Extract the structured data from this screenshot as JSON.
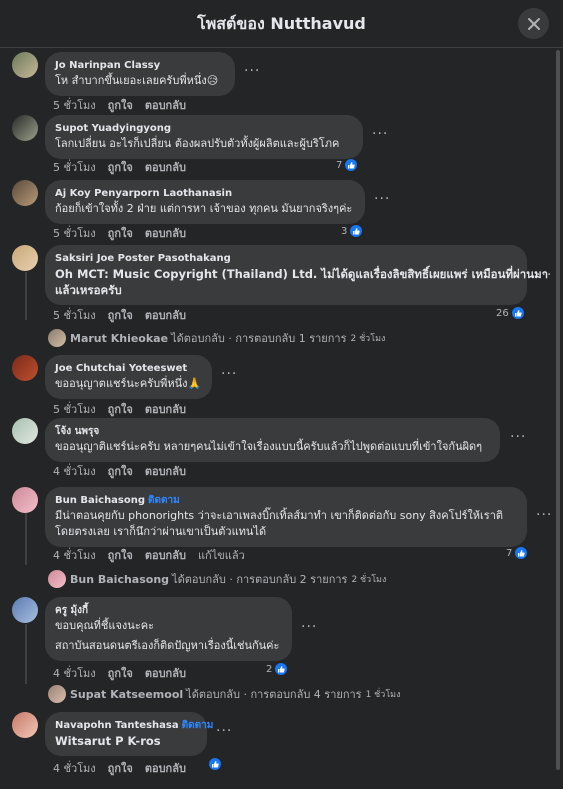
{
  "header": {
    "title": "โพสต์ของ Nutthavud"
  },
  "colors": {
    "background": "#242526",
    "bubble": "#3a3b3c",
    "accent": "#2d88ff",
    "like": "#1877f2"
  },
  "actions": {
    "like": "ถูกใจ",
    "reply": "ตอบกลับ",
    "edit": "แก้ไขแล้ว"
  },
  "comments": [
    {
      "author": "Jo Narinpan Classy",
      "text": "โห สำบากขึ้นเยอะเลยครับพี่หนึ่ง😥",
      "time": "5 ชั่วโมง"
    },
    {
      "author": "Supot Yuadyingyong",
      "text": "โลกเปลี่ยน อะไรก็เปลี่ยน ต้องผลปรับตัวทั้งผู้ผลิตและผู้บริโภค",
      "time": "5 ชั่วโมง",
      "reactions": "7"
    },
    {
      "author": "Aj Koy Penyarporn Laothanasin",
      "text": "ก้อยก็เข้าใจทั้ง 2 ฝ่าย แต่การหา เจ้าของ ทุกคน มันยากจริงๆค่ะ",
      "time": "5 ชั่วโมง",
      "reactions": "3"
    },
    {
      "author": "Saksiri Joe Poster Pasothakang",
      "text1": "Oh MCT: Music Copyright (Thailand) Ltd. ไม่ได้ดูแลเรื่องลิขสิทธิ์เผยแพร่ เหมือนที่ผ่านมา",
      "text2": "แล้วเหรอครับ",
      "time": "5 ชั่วโมง",
      "reactions": "26",
      "reply_summary": {
        "name": "Marut Khieokae",
        "text": "ได้ตอบกลับ · การตอบกลับ 1 รายการ",
        "time": "2 ชั่วโมง"
      }
    },
    {
      "author": "Joe Chutchai Yoteeswet",
      "text": "ขออนุญาตแชร์นะครับพี่หนึ่ง🙏",
      "time": "5 ชั่วโมง"
    },
    {
      "author": "โจ้ง นพรุจ",
      "text": "ขออนุญาติแชร์น่ะครับ หลายๆคนไม่เข้าใจเรื่องแบบนี้ครับแล้วก็ไปพูดต่อแบบที่เข้าใจกันผิดๆ",
      "time": "4 ชั่วโมง"
    },
    {
      "author": "Bun Baichasong",
      "follow": "ติดตาม",
      "text1": "มีน่าตอนคุยกับ phonorights ว่าจะเอาเพลงบิ๊กเทิ้ลส์มาทำ เขาก็ติดต่อกับ sony สิงคโปร์ให้เราติ",
      "text2": "โดยตรงเลย เราก็นึกว่าผ่านเขาเป็นตัวแทนได้",
      "time": "4 ชั่วโมง",
      "reactions": "7",
      "reply_summary": {
        "name": "Bun Baichasong",
        "text": "ได้ตอบกลับ · การตอบกลับ 2 รายการ",
        "time": "2 ชั่วโมง"
      }
    },
    {
      "author": "ครู มุ้งกี้",
      "text1": "ขอบคุณที่ชี้แจงนะคะ",
      "text2": "สถาบันสอนดนตรีเองก็ติดปัญหาเรื่องนี้เช่นกันค่ะ",
      "time": "4 ชั่วโมง",
      "reactions": "2",
      "reply_summary": {
        "name": "Supat Katseemool",
        "text": "ได้ตอบกลับ · การตอบกลับ 4 รายการ",
        "time": "1 ชั่วโมง"
      }
    },
    {
      "author": "Navapohn Tanteshasa",
      "follow": "ติดตาม",
      "text": "Witsarut P K-ros",
      "time": "4 ชั่วโมง"
    }
  ]
}
